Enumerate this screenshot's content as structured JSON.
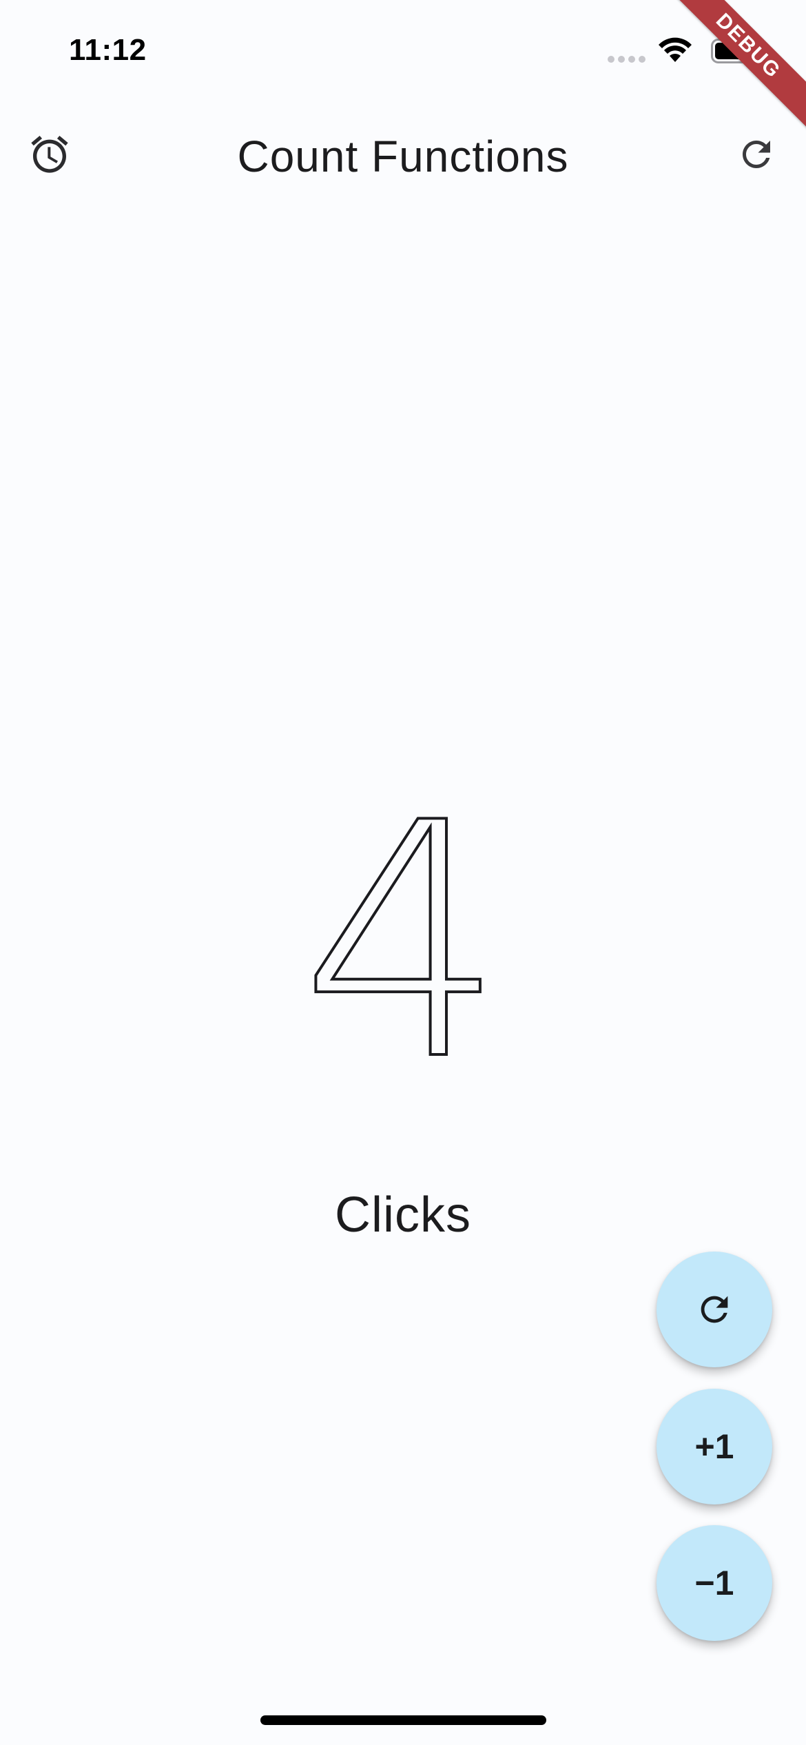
{
  "status_bar": {
    "time": "11:12"
  },
  "app_bar": {
    "title": "Count Functions",
    "left_icon": "alarm-icon",
    "right_icon": "refresh-icon"
  },
  "counter": {
    "value": "4",
    "label": "Clicks"
  },
  "fabs": {
    "reset_icon": "refresh-icon",
    "plus_label": "+1",
    "minus_label": "−1"
  },
  "debug_banner": {
    "label": "DEBUG"
  },
  "colors": {
    "background": "#fbfcfe",
    "fab": "#c2e8fa",
    "debug_ribbon": "#b13b3f"
  }
}
